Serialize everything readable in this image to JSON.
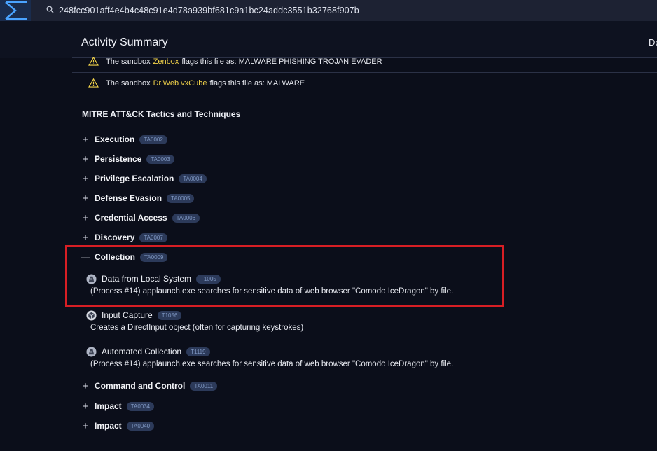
{
  "search": {
    "value": "248fcc901aff4e4b4c48c91e4d78a939bf681c9a1bc24addc3551b32768f907b"
  },
  "section": {
    "title": "Activity Summary",
    "right_label": "Do"
  },
  "sandboxes": [
    {
      "prefix": "The sandbox",
      "name": "Zenbox",
      "suffix": "flags this file as: MALWARE PHISHING TROJAN EVADER"
    },
    {
      "prefix": "The sandbox",
      "name": "Dr.Web vxCube",
      "suffix": "flags this file as: MALWARE"
    }
  ],
  "mitre": {
    "title": "MITRE ATT&CK Tactics and Techniques",
    "tactics": [
      {
        "toggle": "+",
        "name": "Execution",
        "id": "TA0002"
      },
      {
        "toggle": "+",
        "name": "Persistence",
        "id": "TA0003"
      },
      {
        "toggle": "+",
        "name": "Privilege Escalation",
        "id": "TA0004"
      },
      {
        "toggle": "+",
        "name": "Defense Evasion",
        "id": "TA0005"
      },
      {
        "toggle": "+",
        "name": "Credential Access",
        "id": "TA0006"
      },
      {
        "toggle": "+",
        "name": "Discovery",
        "id": "TA0007"
      },
      {
        "toggle": "—",
        "name": "Collection",
        "id": "TA0009"
      },
      {
        "toggle": "+",
        "name": "Command and Control",
        "id": "TA0011"
      },
      {
        "toggle": "+",
        "name": "Impact",
        "id": "TA0034"
      },
      {
        "toggle": "+",
        "name": "Impact",
        "id": "TA0040"
      }
    ],
    "techniques": [
      {
        "name": "Data from Local System",
        "id": "T1005",
        "icon": "sandbox-icon",
        "desc": "(Process #14) applaunch.exe searches for sensitive data of web browser \"Comodo IceDragon\" by file."
      },
      {
        "name": "Input Capture",
        "id": "T1056",
        "icon": "cube-icon",
        "desc": "Creates a DirectInput object (often for capturing keystrokes)"
      },
      {
        "name": "Automated Collection",
        "id": "T1119",
        "icon": "sandbox-icon",
        "desc": "(Process #14) applaunch.exe searches for sensitive data of web browser \"Comodo IceDragon\" by file."
      }
    ]
  },
  "colors": {
    "accent": "#4aa3ff",
    "highlight": "#d81e24",
    "sandbox_name": "#f1d24a",
    "pill_bg": "#2c3a5a"
  }
}
